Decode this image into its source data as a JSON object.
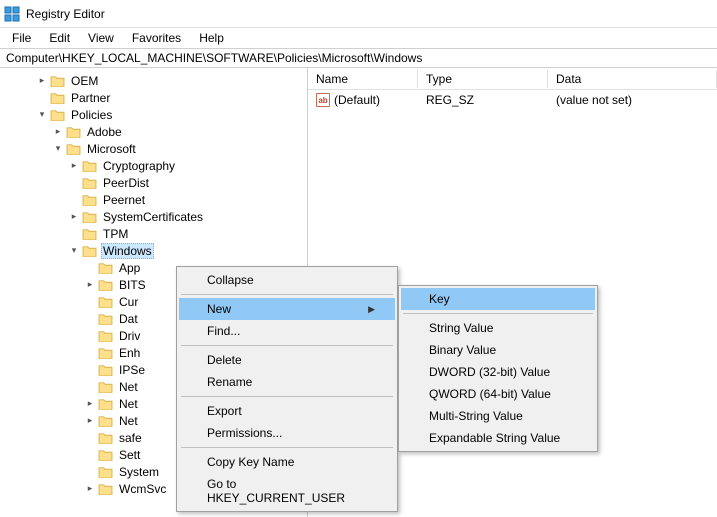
{
  "app": {
    "title": "Registry Editor"
  },
  "menubar": {
    "file": "File",
    "edit": "Edit",
    "view": "View",
    "favorites": "Favorites",
    "help": "Help"
  },
  "address": "Computer\\HKEY_LOCAL_MACHINE\\SOFTWARE\\Policies\\Microsoft\\Windows",
  "list": {
    "cols": {
      "name": "Name",
      "type": "Type",
      "data": "Data"
    },
    "rows": [
      {
        "icon": "ab",
        "name": "(Default)",
        "type": "REG_SZ",
        "data": "(value not set)"
      }
    ]
  },
  "tree": {
    "oem": "OEM",
    "partner": "Partner",
    "policies": "Policies",
    "adobe": "Adobe",
    "microsoft": "Microsoft",
    "cryptography": "Cryptography",
    "peerdist": "PeerDist",
    "peernet": "Peernet",
    "systemcertificates": "SystemCertificates",
    "tpm": "TPM",
    "windows": "Windows",
    "appcompat": "App",
    "bits": "BITS",
    "cur": "Cur",
    "dat": "Dat",
    "driv": "Driv",
    "enh": "Enh",
    "ipse": "IPSe",
    "net1": "Net",
    "net2": "Net",
    "net3": "Net",
    "safe": "safe",
    "sett": "Sett",
    "system": "System",
    "wcmsvc": "WcmSvc"
  },
  "ctx": {
    "collapse": "Collapse",
    "new": "New",
    "find": "Find...",
    "delete": "Delete",
    "rename": "Rename",
    "export": "Export",
    "permissions": "Permissions...",
    "copykey": "Copy Key Name",
    "gohkcu": "Go to HKEY_CURRENT_USER"
  },
  "ctxnew": {
    "key": "Key",
    "string": "String Value",
    "binary": "Binary Value",
    "dword": "DWORD (32-bit) Value",
    "qword": "QWORD (64-bit) Value",
    "multi": "Multi-String Value",
    "expand": "Expandable String Value"
  }
}
